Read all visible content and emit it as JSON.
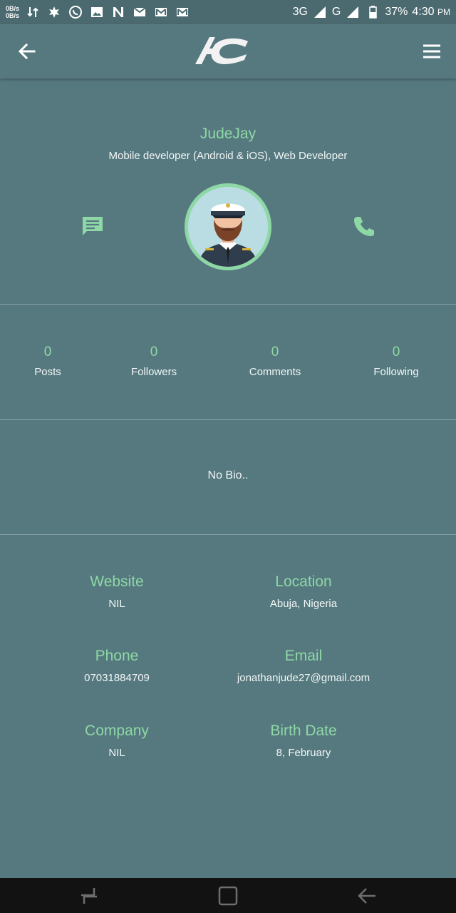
{
  "status_bar": {
    "net_up": "0B/s",
    "net_down": "0B/s",
    "network_3g": "3G",
    "network_g": "G",
    "battery": "37%",
    "time": "4:30",
    "ampm": "PM"
  },
  "app_bar": {
    "logo_text": "</>"
  },
  "profile": {
    "name": "JudeJay",
    "title": "Mobile developer (Android & iOS), Web Developer"
  },
  "stats": [
    {
      "count": "0",
      "label": "Posts"
    },
    {
      "count": "0",
      "label": "Followers"
    },
    {
      "count": "0",
      "label": "Comments"
    },
    {
      "count": "0",
      "label": "Following"
    }
  ],
  "bio": "No Bio..",
  "details": {
    "website": {
      "label": "Website",
      "value": "NIL"
    },
    "location": {
      "label": "Location",
      "value": "Abuja, Nigeria"
    },
    "phone": {
      "label": "Phone",
      "value": "07031884709"
    },
    "email": {
      "label": "Email",
      "value": "jonathanjude27@gmail.com"
    },
    "company": {
      "label": "Company",
      "value": "NIL"
    },
    "birth_date": {
      "label": "Birth Date",
      "value": "8, February"
    }
  },
  "colors": {
    "background": "#56797f",
    "accent": "#8ed8a6",
    "nav_bar": "#121212"
  }
}
